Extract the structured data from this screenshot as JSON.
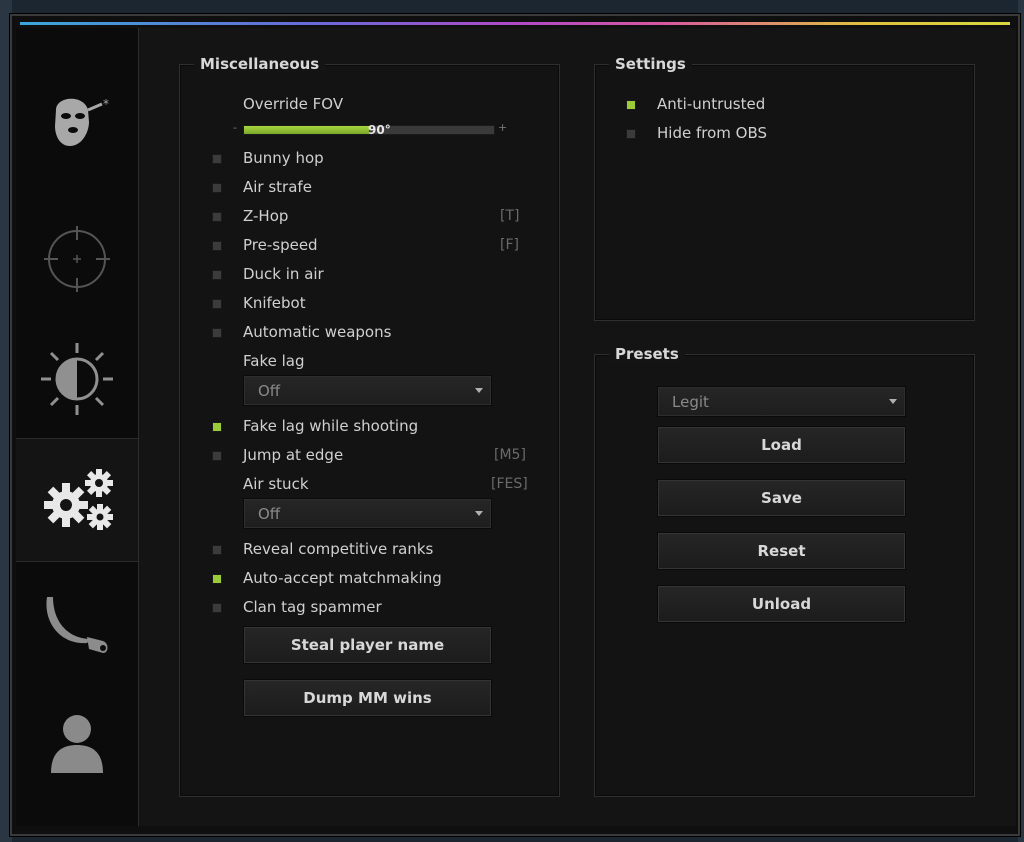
{
  "colors": {
    "accent": "#9ccb3a",
    "checkbox_off": "#3b3b3b"
  },
  "sidebar": {
    "tabs": [
      {
        "name": "ragebot",
        "icon": "masked-head-icon"
      },
      {
        "name": "legitbot",
        "icon": "crosshair-icon"
      },
      {
        "name": "visuals",
        "icon": "brightness-icon"
      },
      {
        "name": "misc",
        "icon": "gears-icon",
        "active": true
      },
      {
        "name": "skins",
        "icon": "karambit-icon"
      },
      {
        "name": "players",
        "icon": "user-icon"
      }
    ]
  },
  "misc": {
    "title": "Miscellaneous",
    "override_fov": {
      "label": "Override FOV",
      "value": "90°",
      "min_mark": "-",
      "max_mark": "+",
      "fraction": 0.5
    },
    "bunny_hop": {
      "label": "Bunny hop",
      "checked": false
    },
    "air_strafe": {
      "label": "Air strafe",
      "checked": false
    },
    "z_hop": {
      "label": "Z-Hop",
      "key": "[T]",
      "checked": false
    },
    "pre_speed": {
      "label": "Pre-speed",
      "key": "[F]",
      "checked": false
    },
    "duck_in_air": {
      "label": "Duck in air",
      "checked": false
    },
    "knifebot": {
      "label": "Knifebot",
      "checked": false
    },
    "automatic_weapons": {
      "label": "Automatic weapons",
      "checked": false
    },
    "fake_lag": {
      "label": "Fake lag",
      "value": "Off"
    },
    "fake_lag_shooting": {
      "label": "Fake lag while shooting",
      "checked": true
    },
    "jump_at_edge": {
      "label": "Jump at edge",
      "key": "[M5]",
      "checked": false
    },
    "air_stuck": {
      "label": "Air stuck",
      "key": "[FES]",
      "value": "Off"
    },
    "reveal_ranks": {
      "label": "Reveal competitive ranks",
      "checked": false
    },
    "auto_accept": {
      "label": "Auto-accept matchmaking",
      "checked": true
    },
    "clan_tag": {
      "label": "Clan tag spammer",
      "checked": false
    },
    "steal_name": "Steal player name",
    "dump_wins": "Dump MM wins"
  },
  "settings": {
    "title": "Settings",
    "anti_untrusted": {
      "label": "Anti-untrusted",
      "checked": true
    },
    "hide_obs": {
      "label": "Hide from OBS",
      "checked": false
    }
  },
  "presets": {
    "title": "Presets",
    "selected": "Legit",
    "load": "Load",
    "save": "Save",
    "reset": "Reset",
    "unload": "Unload"
  }
}
